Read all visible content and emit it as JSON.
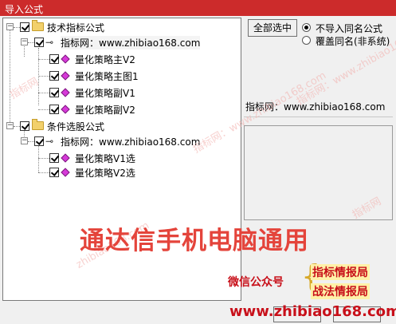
{
  "window": {
    "title": "导入公式"
  },
  "tree": {
    "groups": [
      {
        "label": "技术指标公式",
        "source": "指标网：www.zhibiao168.com",
        "items": [
          "量化策略主V2",
          "量化策略主图1",
          "量化策略副V1",
          "量化策略副V2"
        ]
      },
      {
        "label": "条件选股公式",
        "source": "指标网：www.zhibiao168.com",
        "items": [
          "量化策略V1选",
          "量化策略V2选"
        ]
      }
    ]
  },
  "controls": {
    "select_all_label": "全部选中",
    "radio_no_import": "不导入同名公式",
    "radio_overwrite": "覆盖同名(非系统)",
    "info_text": "指标网：www.zhibiao168.com"
  },
  "overlay": {
    "headline": "通达信手机电脑通用",
    "wechat_label": "微信公众号",
    "pill_1": "指标情报局",
    "pill_2": "战法情报局",
    "site": "www.zhibiao168.com",
    "watermark": "指标网：www.zhibiao168.com",
    "watermark_short": "指标网",
    "watermark_site": "zhibiao168.com"
  },
  "colors": {
    "titlebar": "#cc2b2b",
    "headline": "#e4443b",
    "accent_red": "#c8101a"
  }
}
